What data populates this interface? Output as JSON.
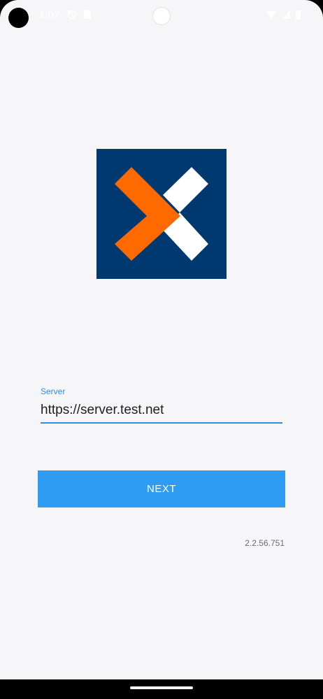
{
  "status_bar": {
    "time": "1:07",
    "icons": [
      "alarm-off-icon",
      "sim-card-icon",
      "wifi-icon",
      "signal-icon",
      "battery-icon"
    ]
  },
  "logo": {
    "background_color": "#003870",
    "accent_color": "#ff6a00",
    "secondary_color": "#ffffff"
  },
  "server_field": {
    "label": "Server",
    "value": "https://server.test.net"
  },
  "next_button": {
    "label": "NEXT",
    "color": "#2f9cf3"
  },
  "version": "2.2.56.751"
}
